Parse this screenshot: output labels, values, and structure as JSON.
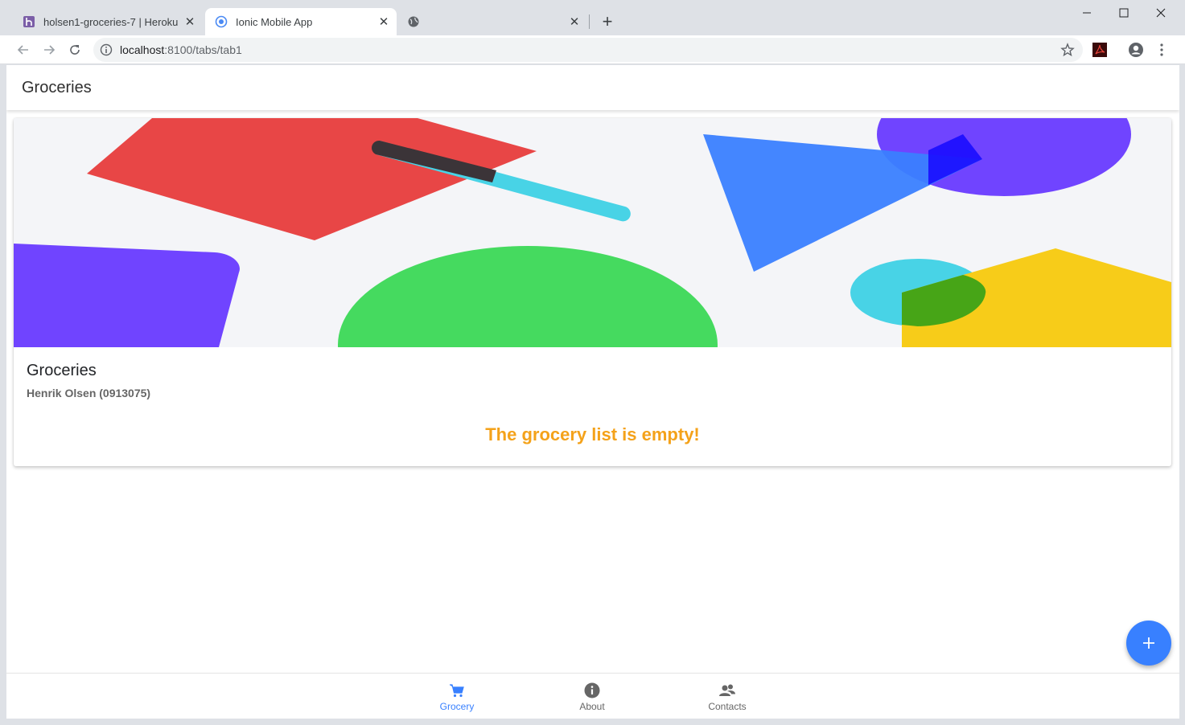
{
  "browser": {
    "tabs": [
      {
        "title": "holsen1-groceries-7 | Heroku",
        "favicon": "heroku-icon",
        "active": false
      },
      {
        "title": "Ionic Mobile App",
        "favicon": "ionic-icon",
        "active": true
      },
      {
        "title": "",
        "favicon": "globe-icon",
        "active": false
      }
    ],
    "address": {
      "host": "localhost",
      "path": ":8100/tabs/tab1"
    }
  },
  "app": {
    "header_title": "Groceries",
    "card": {
      "title": "Groceries",
      "subtitle": "Henrik Olsen (0913075)",
      "empty_message": "The grocery list is empty!"
    },
    "fab_label": "+",
    "tabs": [
      {
        "label": "Grocery",
        "icon": "cart-icon",
        "selected": true
      },
      {
        "label": "About",
        "icon": "info-icon",
        "selected": false
      },
      {
        "label": "Contacts",
        "icon": "people-icon",
        "selected": false
      }
    ]
  },
  "colors": {
    "primary": "#3880ff",
    "warning": "#f4a21a"
  }
}
